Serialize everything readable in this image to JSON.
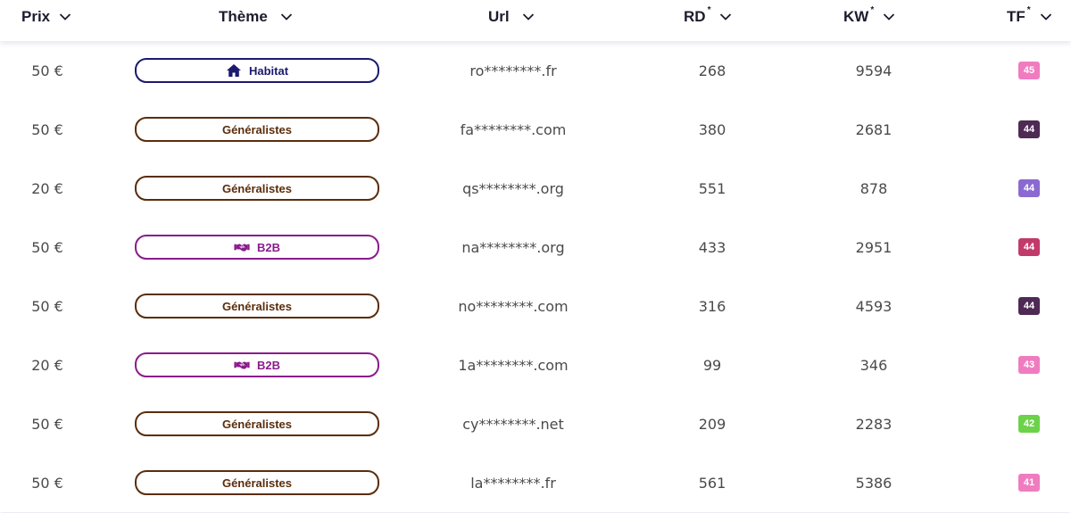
{
  "columns": {
    "prix": "Prix",
    "theme": "Thème",
    "url": "Url",
    "rd": "RD",
    "kw": "KW",
    "tf": "TF",
    "asterisk": "*"
  },
  "rows": [
    {
      "prix": "50 €",
      "theme": "Habitat",
      "theme_icon": "house-icon",
      "theme_color": "#1b1a6e",
      "url": "ro********.fr",
      "rd": "268",
      "kw": "9594",
      "tf": "45",
      "tf_color": "#f07cc0"
    },
    {
      "prix": "50 €",
      "theme": "Généralistes",
      "theme_icon": "",
      "theme_color": "#5a2d0c",
      "url": "fa********.com",
      "rd": "380",
      "kw": "2681",
      "tf": "44",
      "tf_color": "#4e2a55"
    },
    {
      "prix": "20 €",
      "theme": "Généralistes",
      "theme_icon": "",
      "theme_color": "#5a2d0c",
      "url": "qs********.org",
      "rd": "551",
      "kw": "878",
      "tf": "44",
      "tf_color": "#8a6ad0"
    },
    {
      "prix": "50 €",
      "theme": "B2B",
      "theme_icon": "handshake-icon",
      "theme_color": "#8a1b8c",
      "url": "na********.org",
      "rd": "433",
      "kw": "2951",
      "tf": "44",
      "tf_color": "#c23a6a"
    },
    {
      "prix": "50 €",
      "theme": "Généralistes",
      "theme_icon": "",
      "theme_color": "#5a2d0c",
      "url": "no********.com",
      "rd": "316",
      "kw": "4593",
      "tf": "44",
      "tf_color": "#4e2a55"
    },
    {
      "prix": "20 €",
      "theme": "B2B",
      "theme_icon": "handshake-icon",
      "theme_color": "#8a1b8c",
      "url": "1a********.com",
      "rd": "99",
      "kw": "346",
      "tf": "43",
      "tf_color": "#f07cc0"
    },
    {
      "prix": "50 €",
      "theme": "Généralistes",
      "theme_icon": "",
      "theme_color": "#5a2d0c",
      "url": "cy********.net",
      "rd": "209",
      "kw": "2283",
      "tf": "42",
      "tf_color": "#6cd24a"
    },
    {
      "prix": "50 €",
      "theme": "Généralistes",
      "theme_icon": "",
      "theme_color": "#5a2d0c",
      "url": "la********.fr",
      "rd": "561",
      "kw": "5386",
      "tf": "41",
      "tf_color": "#f07cc0"
    }
  ]
}
